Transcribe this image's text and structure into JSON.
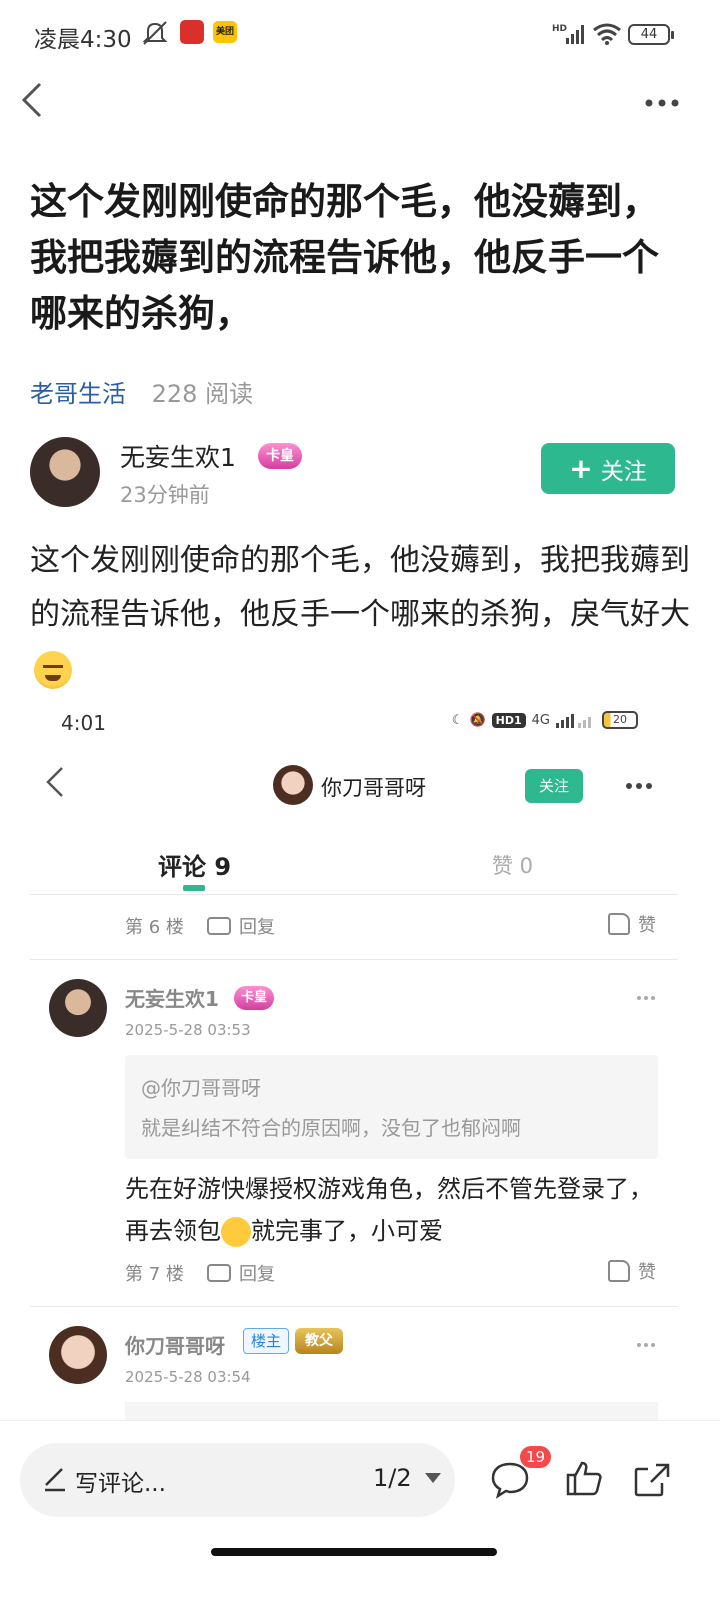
{
  "status_bar": {
    "time": "凌晨4:30",
    "app2_label": "美团",
    "signal": "HD",
    "battery": "44"
  },
  "header": {
    "back_icon": "chevron-left-icon",
    "more_icon": "more-horizontal-icon"
  },
  "post": {
    "title": "这个发刚刚使命的那个毛，他没薅到，我把我薅到的流程告诉他，他反手一个哪来的杀狗，",
    "circle": "老哥生活",
    "reads": "228 阅读",
    "author": {
      "name": "无妄生欢1",
      "badge": "卡皇",
      "time": "23分钟前"
    },
    "follow_label": "关注",
    "content": "这个发刚刚使命的那个毛，他没薅到，我把我薅到的流程告诉他，他反手一个哪来的杀狗，戾气好大"
  },
  "screenshot": {
    "time": "4:01",
    "network": "4G",
    "hd_label": "HD1",
    "battery": "20",
    "user_name": "你刀哥哥呀",
    "follow_label": "关注",
    "tabs": [
      {
        "label": "评论 9"
      },
      {
        "label": "赞 0"
      }
    ],
    "floor6": "第 6 楼",
    "reply_label": "回复",
    "like_label": "赞",
    "comment1": {
      "name": "无妄生欢1",
      "badge": "卡皇",
      "time": "2025-5-28 03:53",
      "quote_at": "@你刀哥哥呀",
      "quote_text": "就是纠结不符合的原因啊，没包了也郁闷啊",
      "text_part1": "先在好游快爆授权游戏角色，然后不管先登录了，再去领包",
      "text_part2": "就完事了，小可爱",
      "floor": "第 7 楼"
    },
    "comment2": {
      "name": "你刀哥哥呀",
      "owner_badge": "楼主",
      "rank_badge": "教父",
      "time": "2025-5-28 03:54"
    }
  },
  "bottom_bar": {
    "input_placeholder": "写评论...",
    "page_indicator": "1/2",
    "comment_count": "19"
  }
}
